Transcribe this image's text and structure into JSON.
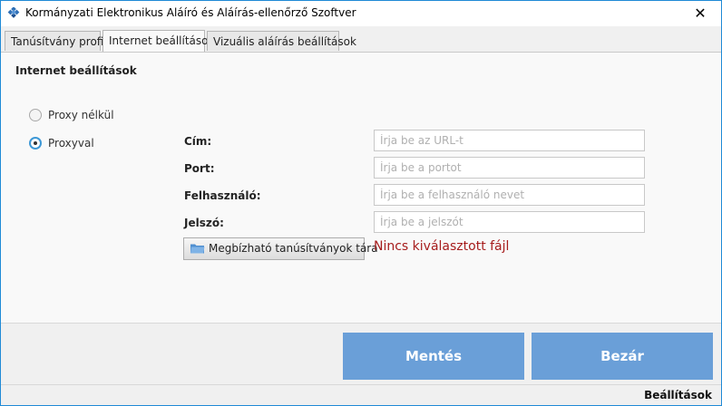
{
  "window": {
    "title": "Kormányzati Elektronikus Aláíró és Aláírás-ellenőrző Szoftver",
    "close_glyph": "✕",
    "app_icon": "diamond-grid-icon"
  },
  "tabs": [
    {
      "label": "Tanúsítvány profil",
      "active": false
    },
    {
      "label": "Internet beállítások",
      "active": true
    },
    {
      "label": "Vizuális aláírás beállítások",
      "active": false
    }
  ],
  "section": {
    "title": "Internet beállítások"
  },
  "proxy_options": [
    {
      "label": "Proxy nélkül",
      "checked": false
    },
    {
      "label": "Proxyval",
      "checked": true
    }
  ],
  "fields": [
    {
      "label": "Cím:",
      "placeholder": "Írja be az URL-t",
      "value": ""
    },
    {
      "label": "Port:",
      "placeholder": "Írja be a portot",
      "value": ""
    },
    {
      "label": "Felhasználó:",
      "placeholder": "Írja be a felhasználó nevet",
      "value": ""
    },
    {
      "label": "Jelszó:",
      "placeholder": "Írja be a jelszót",
      "value": ""
    }
  ],
  "trust_store": {
    "button_label": "Megbízható tanúsítványok tára",
    "icon": "folder-icon",
    "status": "Nincs kiválasztott fájl",
    "status_color": "#a61c1c"
  },
  "footer": {
    "save_label": "Mentés",
    "close_label": "Bezár",
    "button_color": "#6a9fd8"
  },
  "statusbar": {
    "text": "Beállítások"
  }
}
